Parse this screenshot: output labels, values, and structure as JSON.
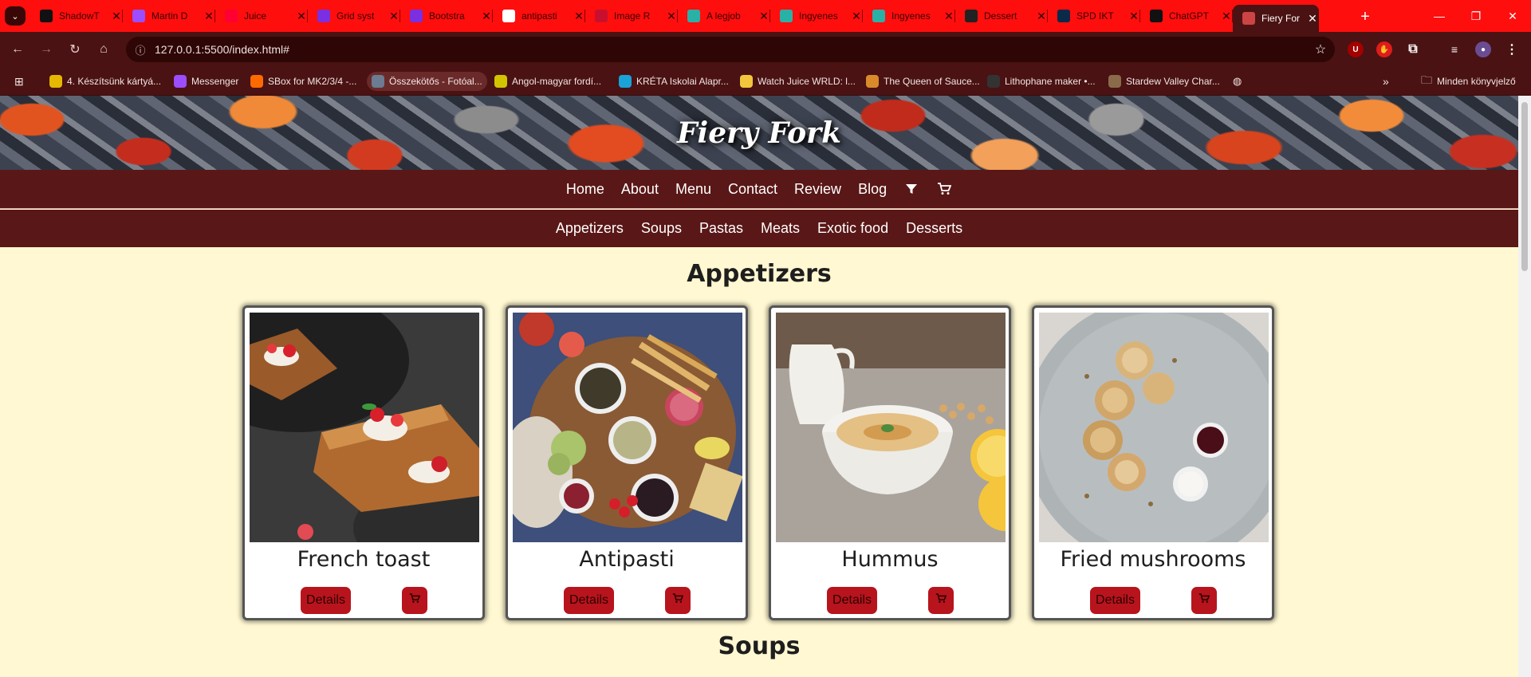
{
  "browser": {
    "tabs": [
      {
        "title": "ShadowT",
        "icon": "github-icon",
        "color": "#111111"
      },
      {
        "title": "Martin D",
        "icon": "messenger-icon",
        "color": "#9b4dff"
      },
      {
        "title": "Juice",
        "icon": "youtube-icon",
        "color": "#ff0033"
      },
      {
        "title": "Grid syst",
        "icon": "bootstrap-icon",
        "color": "#7a2fe0"
      },
      {
        "title": "Bootstra",
        "icon": "bootstrap-icon",
        "color": "#7a2fe0"
      },
      {
        "title": "antipasti",
        "icon": "google-icon",
        "color": "#ffffff"
      },
      {
        "title": "Image R",
        "icon": "image-icon",
        "color": "#c8102e"
      },
      {
        "title": "A legjob",
        "icon": "site-icon",
        "color": "#2bb0a6"
      },
      {
        "title": "Ingyenes",
        "icon": "site-icon",
        "color": "#2bb0a6"
      },
      {
        "title": "Ingyenes",
        "icon": "site-icon",
        "color": "#2bb0a6"
      },
      {
        "title": "Dessert",
        "icon": "grk-icon",
        "color": "#222222"
      },
      {
        "title": "SPD IKT",
        "icon": "trello-icon",
        "color": "#0b2a4a"
      },
      {
        "title": "ChatGPT",
        "icon": "chatgpt-icon",
        "color": "#111111"
      },
      {
        "title": "Fiery For",
        "icon": "fiery-fork-icon",
        "color": "#c44"
      }
    ],
    "url": "127.0.0.1:5500/index.html#",
    "bookmarks": [
      {
        "label": "4. Készítsünk kártyá...",
        "color": "#e6b800"
      },
      {
        "label": "Messenger",
        "color": "#9b4dff"
      },
      {
        "label": "SBox for MK2/3/4 -...",
        "color": "#ff6a00"
      },
      {
        "label": "Összekötős - Fotóal...",
        "color": "#6b7c93"
      },
      {
        "label": "Angol-magyar fordí...",
        "color": "#d4c400"
      },
      {
        "label": "KRÉTA Iskolai Alapr...",
        "color": "#1aa3d9"
      },
      {
        "label": "Watch Juice WRLD: l...",
        "color": "#f2c53d"
      },
      {
        "label": "The Queen of Sauce...",
        "color": "#d98a2b"
      },
      {
        "label": "Lithophane maker •...",
        "color": "#333333"
      },
      {
        "label": "Stardew Valley Char...",
        "color": "#8a6a4a"
      }
    ],
    "all_bookmarks_label": "Minden könyvjelző"
  },
  "site": {
    "brand": "Fiery Fork",
    "nav_main": [
      "Home",
      "About",
      "Menu",
      "Contact",
      "Review",
      "Blog"
    ],
    "nav_icons": [
      "filter-icon",
      "cart-icon"
    ],
    "nav_categories": [
      "Appetizers",
      "Soups",
      "Pastas",
      "Meats",
      "Exotic food",
      "Desserts"
    ],
    "sections": [
      {
        "title": "Appetizers"
      },
      {
        "title": "Soups"
      }
    ],
    "appetizers": [
      {
        "name": "French toast",
        "details": "Details"
      },
      {
        "name": "Antipasti",
        "details": "Details"
      },
      {
        "name": "Hummus",
        "details": "Details"
      },
      {
        "name": "Fried mushrooms",
        "details": "Details"
      }
    ],
    "colors": {
      "nav_bg": "#5a1717",
      "page_bg": "#fff8d2",
      "button": "#b8141d",
      "tabstrip": "#ff0e0e"
    }
  }
}
